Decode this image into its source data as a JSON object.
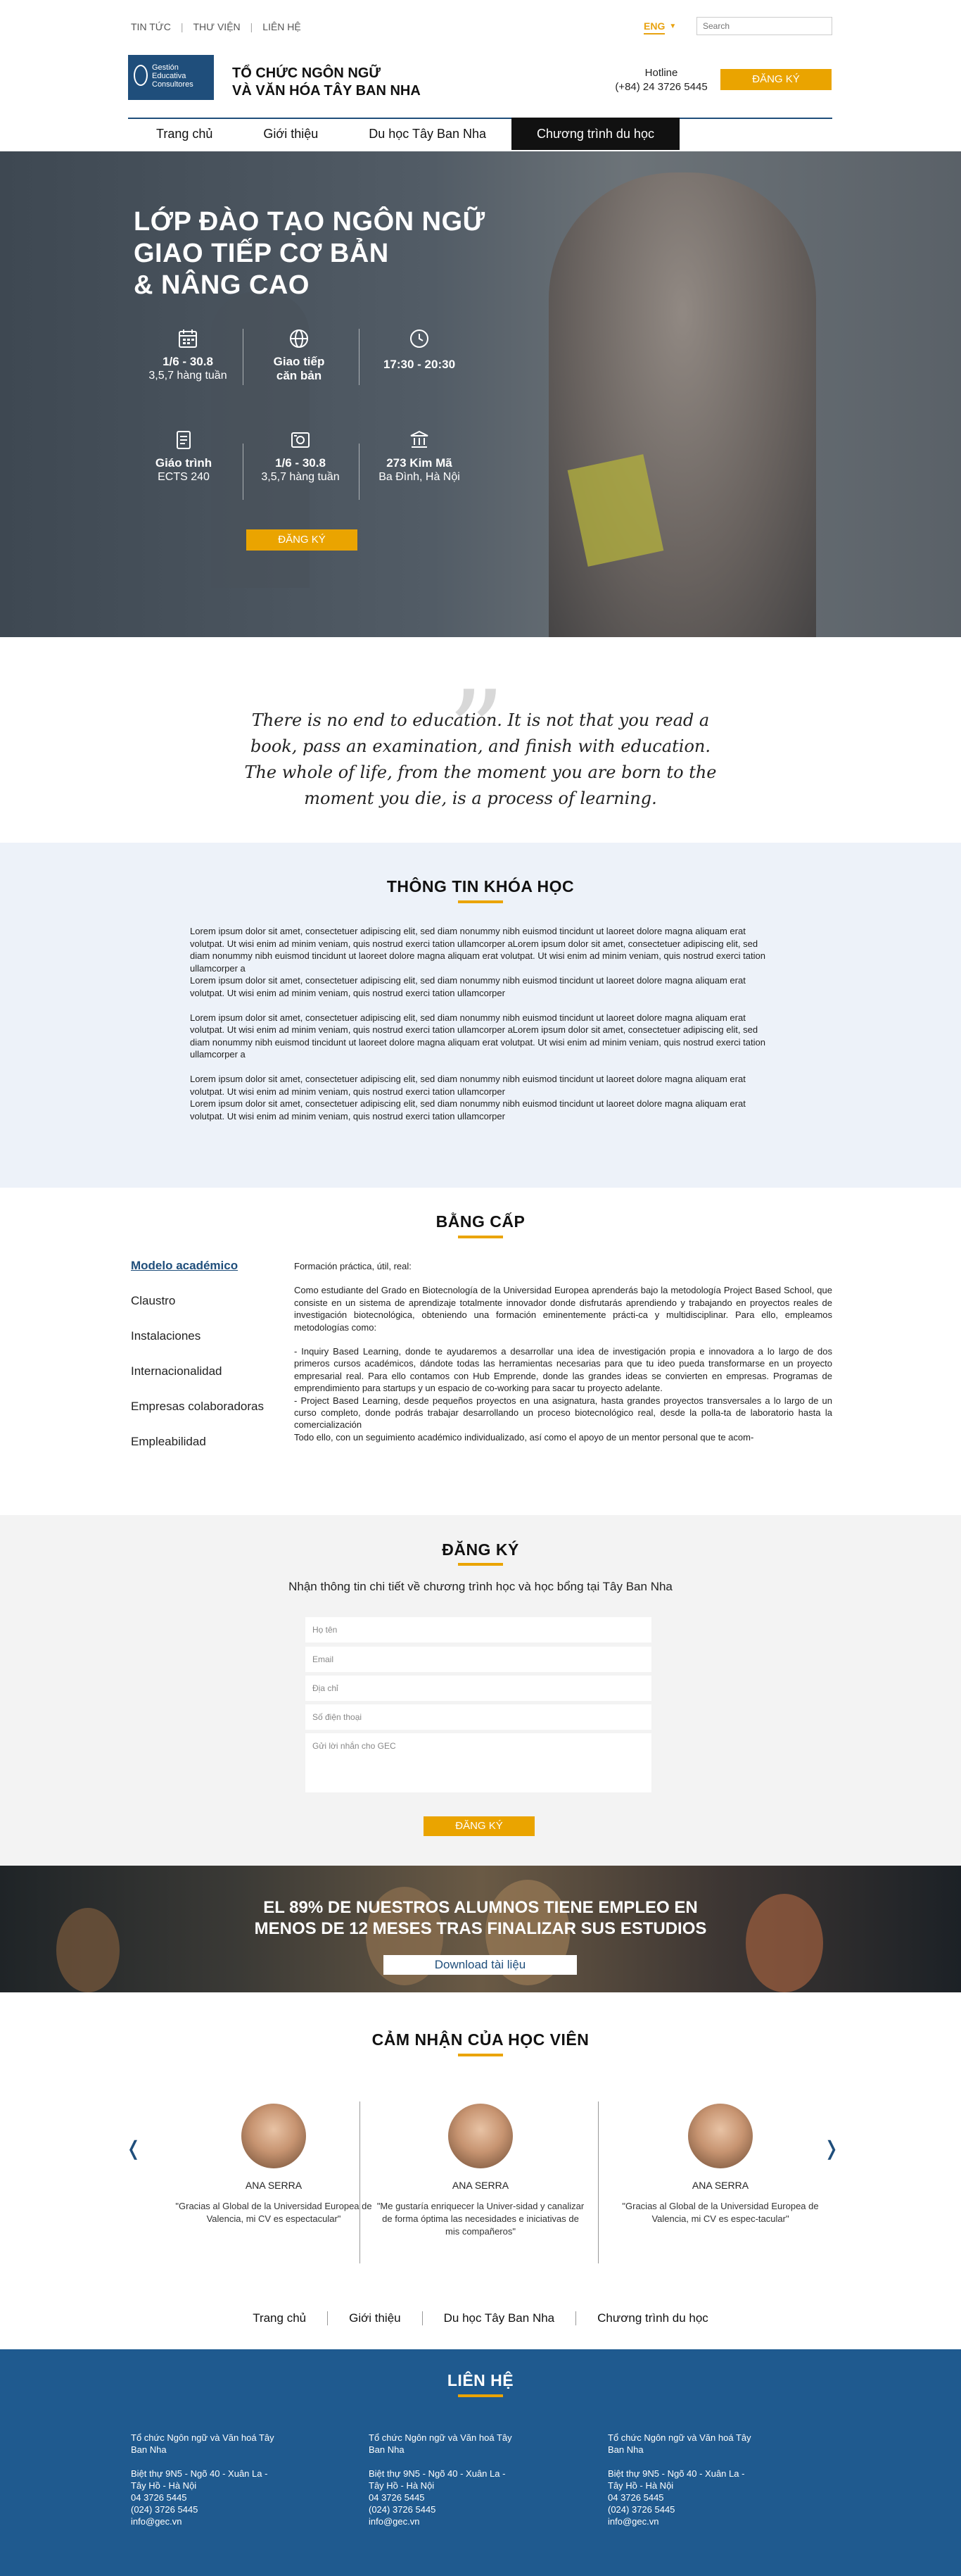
{
  "topbar": {
    "links": [
      "TIN TỨC",
      "THƯ VIỆN",
      "LIÊN HỆ"
    ],
    "language": "ENG",
    "search_placeholder": "Search"
  },
  "header": {
    "logo_text": [
      "Gestión",
      "Educativa",
      "Consultores"
    ],
    "brand_line1": "TỔ CHỨC NGÔN NGỮ",
    "brand_line2": "VÀ VĂN HÓA TÂY BAN NHA",
    "hotline_label": "Hotline",
    "hotline_number": "(+84) 24 3726 5445",
    "signup": "ĐĂNG KÝ"
  },
  "nav": {
    "items": [
      "Trang chủ",
      "Giới thiệu",
      "Du học Tây Ban Nha",
      "Chương trình du học"
    ],
    "active_index": 3
  },
  "hero": {
    "title_lines": [
      "LỚP ĐÀO TẠO NGÔN NGỮ",
      "GIAO TIẾP CƠ BẢN",
      "& NÂNG CAO"
    ],
    "features": [
      {
        "icon": "calendar-icon",
        "title": "1/6 - 30.8",
        "sub": "3,5,7 hàng tuần"
      },
      {
        "icon": "globe-icon",
        "title": "Giao tiếp",
        "sub": "căn bản"
      },
      {
        "icon": "clock-icon",
        "title": "17:30 - 20:30",
        "sub": ""
      },
      {
        "icon": "document-icon",
        "title": "Giáo trình",
        "sub": "ECTS 240"
      },
      {
        "icon": "certificate-icon",
        "title": "1/6 - 30.8",
        "sub": "3,5,7 hàng tuần"
      },
      {
        "icon": "location-icon",
        "title": "273 Kim Mã",
        "sub": "Ba Đình, Hà Nội"
      }
    ],
    "button": "ĐĂNG KÝ"
  },
  "quote": {
    "lines": [
      "There is no end to education. It is not that you read a",
      "book, pass an examination, and finish with education.",
      "The whole of life, from the moment you are born to the",
      "moment you die, is a process of learning."
    ]
  },
  "course_info": {
    "title": "THÔNG TIN KHÓA HỌC",
    "paragraphs": [
      "Lorem ipsum dolor sit amet, consectetuer adipiscing elit, sed diam nonummy nibh euismod tincidunt ut laoreet dolore magna aliquam erat volutpat. Ut wisi enim ad minim veniam, quis nostrud exerci tation ullamcorper aLorem ipsum dolor sit amet, consectetuer adipiscing elit, sed diam nonummy nibh euismod tincidunt ut laoreet dolore magna aliquam erat volutpat. Ut wisi enim ad minim veniam, quis nostrud exerci tation ullamcorper a",
      "Lorem ipsum dolor sit amet, consectetuer adipiscing elit, sed diam nonummy nibh euismod tincidunt ut laoreet dolore magna aliquam erat volutpat. Ut wisi enim ad minim veniam, quis nostrud exerci tation ullamcorper",
      "Lorem ipsum dolor sit amet, consectetuer adipiscing elit, sed diam nonummy nibh euismod tincidunt ut laoreet dolore magna aliquam erat volutpat. Ut wisi enim ad minim veniam, quis nostrud exerci tation ullamcorper aLorem ipsum dolor sit amet, consectetuer adipiscing elit, sed diam nonummy nibh euismod tincidunt ut laoreet dolore magna aliquam erat volutpat. Ut wisi enim ad minim veniam, quis nostrud exerci tation ullamcorper a",
      "Lorem ipsum dolor sit amet, consectetuer adipiscing elit, sed diam nonummy nibh euismod tincidunt ut laoreet dolore magna aliquam erat volutpat. Ut wisi enim ad minim veniam, quis nostrud exerci tation ullamcorper",
      "Lorem ipsum dolor sit amet, consectetuer adipiscing elit, sed diam nonummy nibh euismod tincidunt ut laoreet dolore magna aliquam erat volutpat. Ut wisi enim ad minim veniam, quis nostrud exerci tation ullamcorper"
    ]
  },
  "degree": {
    "title": "BẰNG CẤP",
    "menu": [
      "Modelo académico",
      "Claustro",
      "Instalaciones",
      "Internacionalidad",
      "Empresas colaboradoras",
      "Empleabilidad"
    ],
    "active_index": 0,
    "paragraphs": [
      "Formación práctica, útil, real:",
      "Como estudiante del Grado en Biotecnología de la Universidad Europea aprenderás bajo la metodología Project Based School, que consiste en un sistema de aprendizaje totalmente innovador donde disfrutarás aprendiendo y trabajando en proyectos reales de investigación biotecnológica, obteniendo una formación eminentemente prácti-ca y multidisciplinar. Para ello, empleamos metodologías como:",
      "- Inquiry Based Learning, donde te ayudaremos a desarrollar una idea de investigación propia e innovadora a lo largo de dos primeros cursos académicos, dándote todas las herramientas necesarias para que tu ideo pueda transformarse en un proyecto empresarial real. Para ello contamos con Hub Emprende, donde las grandes ideas se convierten en empresas. Programas de emprendimiento para startups y un espacio de co-working para sacar tu proyecto adelante.",
      "- Project Based Learning, desde pequeños proyectos en una asignatura, hasta grandes proyectos transversales a lo largo de un curso completo, donde podrás trabajar desarrollando un proceso biotecnológico real, desde la polla-ta de laboratorio hasta la comercialización",
      "Todo ello, con un seguimiento académico individualizado, así como el apoyo de un mentor personal que te acom-"
    ]
  },
  "register": {
    "title": "ĐĂNG KÝ",
    "subtitle": "Nhận thông tin chi tiết về chương trình học và học bổng tại Tây Ban Nha",
    "fields": [
      "Họ tên",
      "Email",
      "Địa chỉ",
      "Số điện thoại",
      "Gửi lời nhắn cho GEC"
    ],
    "button": "ĐĂNG KÝ"
  },
  "banner": {
    "line1": "EL 89% DE NUESTROS ALUMNOS TIENE EMPLEO EN",
    "line2": "MENOS DE 12 MESES TRAS FINALIZAR SUS ESTUDIOS",
    "button": "Download tài liệu"
  },
  "reviews": {
    "title": "CẢM NHẬN CỦA HỌC VIÊN",
    "items": [
      {
        "name": "ANA SERRA",
        "text": "\"Gracias al Global de la Universidad Europea de Valencia, mi CV es espectacular\""
      },
      {
        "name": "ANA SERRA",
        "text": "\"Me gustaría enriquecer la Univer-sidad y canalizar de forma óptima las necesidades e iniciativas de mis compañeros\""
      },
      {
        "name": "ANA SERRA",
        "text": "\"Gracias al Global de la Universidad Europea de Valencia, mi CV es espec-tacular\""
      }
    ],
    "prev": "❬",
    "next": "❭"
  },
  "footer_nav": [
    "Trang chủ",
    "Giới thiệu",
    "Du học Tây Ban Nha",
    "Chương trình du học"
  ],
  "contact": {
    "title": "LIÊN HỆ",
    "columns": [
      {
        "name_lines": [
          "Tổ chức Ngôn ngữ và Văn hoá Tây",
          "Ban Nha"
        ],
        "lines": [
          "Biệt thự 9N5 - Ngõ 40 - Xuân La -",
          "Tây Hồ - Hà Nội",
          "04 3726 5445",
          "(024) 3726 5445",
          "info@gec.vn"
        ]
      },
      {
        "name_lines": [
          "Tổ chức Ngôn ngữ và Văn hoá Tây",
          "Ban Nha"
        ],
        "lines": [
          "Biệt thự 9N5 - Ngõ 40 - Xuân La -",
          "Tây Hồ - Hà Nội",
          "04 3726 5445",
          "(024) 3726 5445",
          "info@gec.vn"
        ]
      },
      {
        "name_lines": [
          "Tổ chức Ngôn ngữ và Văn hoá Tây",
          "Ban Nha"
        ],
        "lines": [
          "Biệt thự 9N5 - Ngõ 40 - Xuân La -",
          "Tây Hồ - Hà Nội",
          "04 3726 5445",
          "(024) 3726 5445",
          "info@gec.vn"
        ]
      }
    ]
  },
  "colors": {
    "accent": "#eaa400",
    "brand": "#1f4e7b",
    "contact_bg": "#1f5a8f",
    "info_bg": "#edf2f9"
  }
}
